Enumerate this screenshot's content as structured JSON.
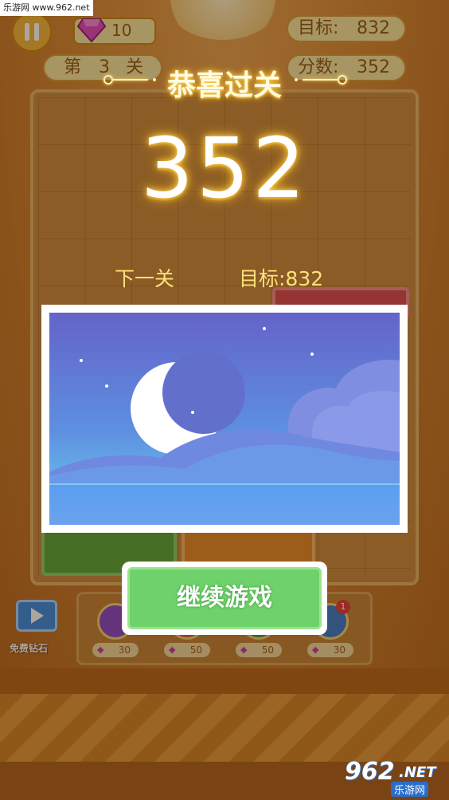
{
  "watermark": {
    "top_text": "乐游网 www.962.net",
    "bottom_logo": "962",
    "bottom_suffix": ".NET",
    "bottom_caption": "乐游网"
  },
  "hud": {
    "gems": "10",
    "target_label": "目标:",
    "target_value": "832",
    "score_label": "分数:",
    "score_value": "352",
    "level_prefix": "第",
    "level_number": "3",
    "level_suffix": "关"
  },
  "dialog": {
    "title": "恭喜过关",
    "score": "352",
    "next_level_label": "下一关",
    "next_target_label": "目标:832",
    "continue_button": "继续游戏"
  },
  "tools": {
    "free_diamonds": "免费钻石",
    "prices": [
      "30",
      "50",
      "50",
      "30"
    ],
    "badge": "1"
  },
  "ad": {
    "scene": "night-moon-illustration"
  },
  "colors": {
    "title_glow": "#ffd24a",
    "continue_green": "#6fd16b",
    "next_text": "#ffe17a"
  }
}
